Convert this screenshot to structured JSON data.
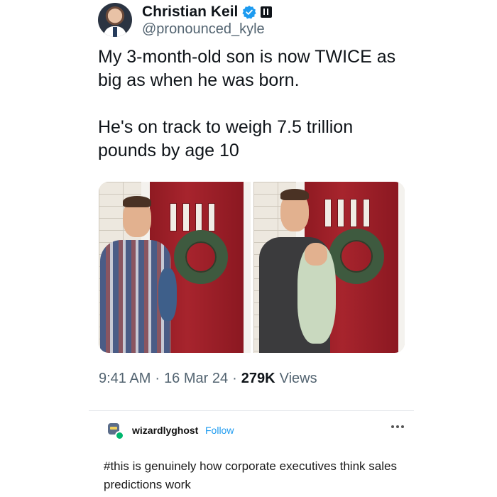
{
  "tweet": {
    "author": {
      "display_name": "Christian Keil",
      "handle": "@pronounced_kyle",
      "verified": true
    },
    "text_paragraphs": [
      "My 3-month-old son is now TWICE as big as when he was born.",
      "He's on track to weigh 7.5 trillion pounds by age 10"
    ],
    "meta": {
      "time": "9:41 AM",
      "date": "16 Mar 24",
      "views_count": "279K",
      "views_label": "Views",
      "separator": "·"
    }
  },
  "comment": {
    "username": "wizardlyghost",
    "follow_label": "Follow",
    "text": "#this is genuinely how corporate executives think sales predictions work"
  },
  "colors": {
    "verified_blue": "#1d9bf0",
    "door_red": "#a7242d",
    "follow_blue": "#1d9bf0"
  }
}
